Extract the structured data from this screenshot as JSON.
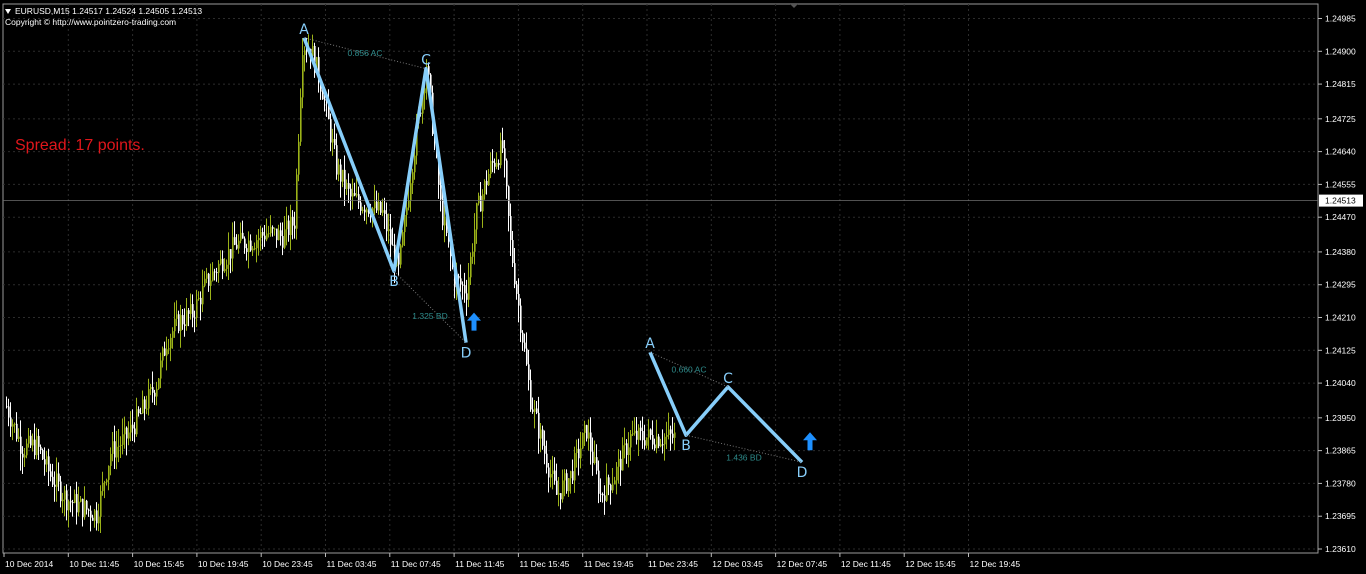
{
  "header": {
    "symbol_line": "EURUSD,M15  1.24517 1.24524 1.24505 1.24513",
    "copyright": "Copyright © http://www.pointzero-trading.com"
  },
  "spread_label": "Spread: 17 points.",
  "colors": {
    "background": "#000000",
    "grid": "#2c2c2c",
    "bull_candle": "#9bb218",
    "bear_candle": "#ffffff",
    "pattern_line": "#87cefa",
    "pattern_text": "#2e8b8b",
    "arrow": "#1e90ff",
    "spread_text": "#e0161b"
  },
  "chart_data": {
    "type": "candlestick",
    "symbol": "EURUSD",
    "timeframe": "M15",
    "current_price": "1.24513",
    "y_ticks": [
      "1.24985",
      "1.24900",
      "1.24815",
      "1.24725",
      "1.24640",
      "1.24555",
      "1.24470",
      "1.24380",
      "1.24295",
      "1.24210",
      "1.24125",
      "1.24040",
      "1.23950",
      "1.23865",
      "1.23780",
      "1.23695",
      "1.23610"
    ],
    "y_range": [
      1.2361,
      1.24985
    ],
    "x_ticks": [
      "10 Dec 2014",
      "10 Dec 11:45",
      "10 Dec 15:45",
      "10 Dec 19:45",
      "10 Dec 23:45",
      "11 Dec 03:45",
      "11 Dec 07:45",
      "11 Dec 11:45",
      "11 Dec 15:45",
      "11 Dec 19:45",
      "11 Dec 23:45",
      "12 Dec 03:45",
      "12 Dec 07:45",
      "12 Dec 11:45",
      "12 Dec 15:45",
      "12 Dec 19:45"
    ],
    "bar_count": 335,
    "price_path": [
      [
        0,
        1.2398
      ],
      [
        8,
        1.2387
      ],
      [
        15,
        1.2388
      ],
      [
        22,
        1.238
      ],
      [
        30,
        1.2374
      ],
      [
        37,
        1.2372
      ],
      [
        45,
        1.237
      ],
      [
        52,
        1.2386
      ],
      [
        60,
        1.239
      ],
      [
        67,
        1.2396
      ],
      [
        75,
        1.2404
      ],
      [
        80,
        1.2415
      ],
      [
        86,
        1.242
      ],
      [
        93,
        1.2422
      ],
      [
        100,
        1.243
      ],
      [
        108,
        1.2436
      ],
      [
        115,
        1.244
      ],
      [
        123,
        1.2441
      ],
      [
        130,
        1.2443
      ],
      [
        138,
        1.2442
      ],
      [
        144,
        1.2446
      ],
      [
        148,
        1.2492
      ],
      [
        152,
        1.2491
      ],
      [
        158,
        1.248
      ],
      [
        165,
        1.246
      ],
      [
        172,
        1.2452
      ],
      [
        180,
        1.245
      ],
      [
        188,
        1.2448
      ],
      [
        196,
        1.2433
      ],
      [
        202,
        1.2458
      ],
      [
        210,
        1.2487
      ],
      [
        217,
        1.245
      ],
      [
        224,
        1.2431
      ],
      [
        230,
        1.2428
      ],
      [
        235,
        1.2448
      ],
      [
        242,
        1.246
      ],
      [
        248,
        1.2465
      ],
      [
        252,
        1.244
      ],
      [
        257,
        1.242
      ],
      [
        262,
        1.24
      ],
      [
        268,
        1.2388
      ],
      [
        275,
        1.2375
      ],
      [
        282,
        1.238
      ],
      [
        290,
        1.2392
      ],
      [
        297,
        1.2375
      ],
      [
        304,
        1.238
      ],
      [
        312,
        1.239
      ]
    ],
    "patterns": [
      {
        "points": [
          {
            "label": "A",
            "bar": 149,
            "price": 1.24935
          },
          {
            "label": "B",
            "bar": 194,
            "price": 1.2433
          },
          {
            "label": "C",
            "bar": 210,
            "price": 1.24855
          },
          {
            "label": "D",
            "bar": 230,
            "price": 1.24145
          }
        ],
        "ratios": [
          "0.856 AC",
          "1.325 BD"
        ]
      },
      {
        "points": [
          {
            "label": "A",
            "bar": 322,
            "price": 1.2412
          },
          {
            "label": "B",
            "bar": 340,
            "price": 1.23905
          },
          {
            "label": "C",
            "bar": 361,
            "price": 1.2403
          },
          {
            "label": "D",
            "bar": 398,
            "price": 1.23835
          }
        ],
        "ratios": [
          "0.660 AC",
          "1.436 BD"
        ]
      }
    ],
    "grid": true
  }
}
